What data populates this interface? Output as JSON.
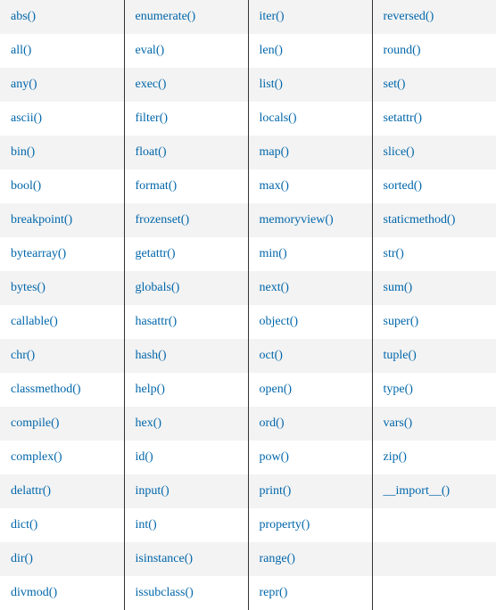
{
  "table": {
    "columns": [
      [
        "abs()",
        "all()",
        "any()",
        "ascii()",
        "bin()",
        "bool()",
        "breakpoint()",
        "bytearray()",
        "bytes()",
        "callable()",
        "chr()",
        "classmethod()",
        "compile()",
        "complex()",
        "delattr()",
        "dict()",
        "dir()",
        "divmod()"
      ],
      [
        "enumerate()",
        "eval()",
        "exec()",
        "filter()",
        "float()",
        "format()",
        "frozenset()",
        "getattr()",
        "globals()",
        "hasattr()",
        "hash()",
        "help()",
        "hex()",
        "id()",
        "input()",
        "int()",
        "isinstance()",
        "issubclass()"
      ],
      [
        "iter()",
        "len()",
        "list()",
        "locals()",
        "map()",
        "max()",
        "memoryview()",
        "min()",
        "next()",
        "object()",
        "oct()",
        "open()",
        "ord()",
        "pow()",
        "print()",
        "property()",
        "range()",
        "repr()"
      ],
      [
        "reversed()",
        "round()",
        "set()",
        "setattr()",
        "slice()",
        "sorted()",
        "staticmethod()",
        "str()",
        "sum()",
        "super()",
        "tuple()",
        "type()",
        "vars()",
        "zip()",
        "__import__()",
        "",
        "",
        ""
      ]
    ]
  }
}
